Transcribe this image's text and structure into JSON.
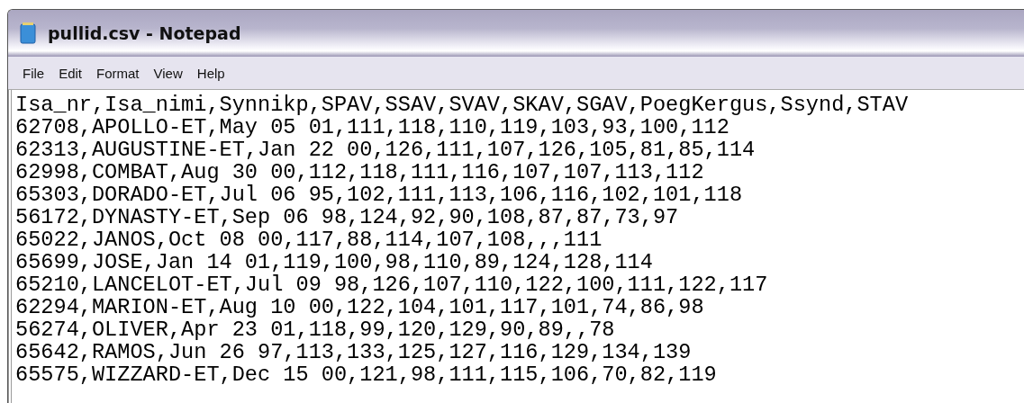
{
  "window": {
    "title": "pullid.csv - Notepad"
  },
  "menu": [
    "File",
    "Edit",
    "Format",
    "View",
    "Help"
  ],
  "lines": [
    "Isa_nr,Isa_nimi,Synnikp,SPAV,SSAV,SVAV,SKAV,SGAV,PoegKergus,Ssynd,STAV",
    "62708,APOLLO-ET,May 05 01,111,118,110,119,103,93,100,112",
    "62313,AUGUSTINE-ET,Jan 22 00,126,111,107,126,105,81,85,114",
    "62998,COMBAT,Aug 30 00,112,118,111,116,107,107,113,112",
    "65303,DORADO-ET,Jul 06 95,102,111,113,106,116,102,101,118",
    "56172,DYNASTY-ET,Sep 06 98,124,92,90,108,87,87,73,97",
    "65022,JANOS,Oct 08 00,117,88,114,107,108,,,111",
    "65699,JOSE,Jan 14 01,119,100,98,110,89,124,128,114",
    "65210,LANCELOT-ET,Jul 09 98,126,107,110,122,100,111,122,117",
    "62294,MARION-ET,Aug 10 00,122,104,101,117,101,74,86,98",
    "56274,OLIVER,Apr 23 01,118,99,120,129,90,89,,78",
    "65642,RAMOS,Jun 26 97,113,133,125,127,116,129,134,139",
    "65575,WIZZARD-ET,Dec 15 00,121,98,111,115,106,70,82,119"
  ]
}
